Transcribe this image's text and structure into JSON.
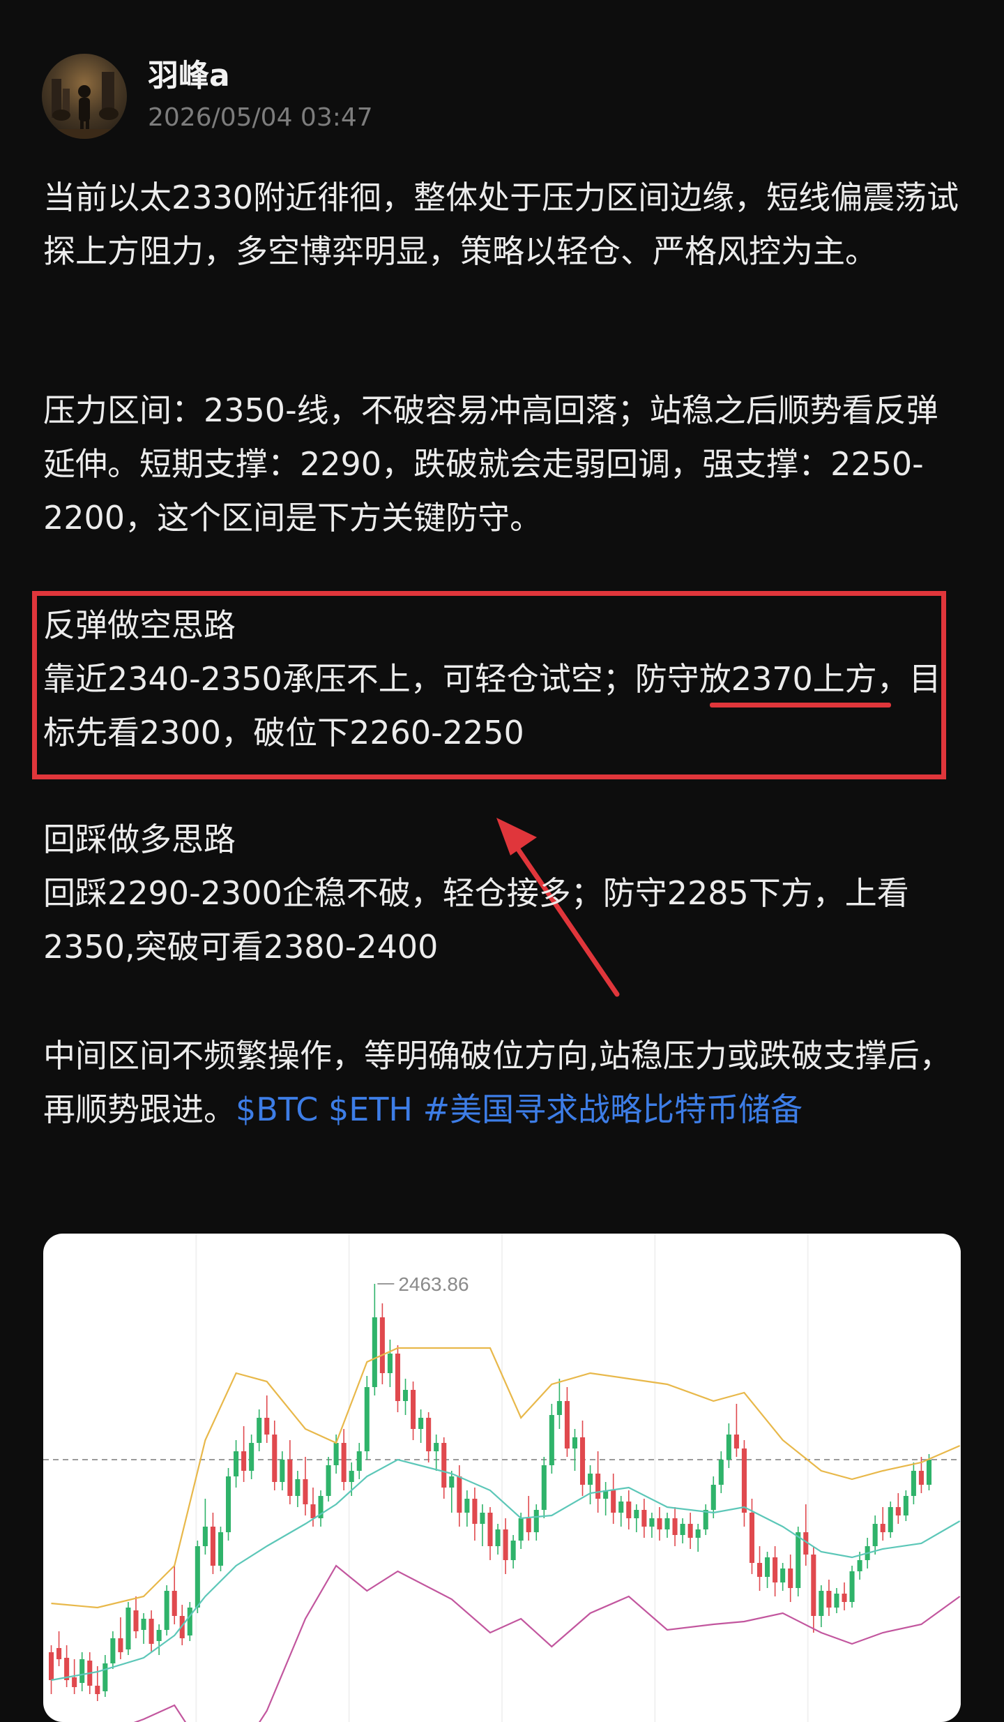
{
  "author": {
    "name": "羽峰a",
    "timestamp": "2026/05/04 03:47"
  },
  "post": {
    "para1": "当前以太2330附近徘徊，整体处于压力区间边缘，短线偏震荡试探上方阻力，多空博弈明显，策略以轻仓、严格风控为主。",
    "para2": "压力区间：2350-线，不破容易冲高回落；站稳之后顺势看反弹延伸。短期支撑：2290，跌破就会走弱回调，强支撑：2250-2200，这个区间是下方关键防守。",
    "para3_title": "反弹做空思路",
    "para3_body": "靠近2340-2350承压不上，可轻仓试空；防守放2370上方，目标先看2300，破位下2260-2250",
    "para4_title": "回踩做多思路",
    "para4_body": "回踩2290-2300企稳不破，轻仓接多；防守2285下方，上看2350,突破可看2380-2400",
    "para5_text": "中间区间不频繁操作，等明确破位方向,站稳压力或跌破支撑后，再顺势跟进。",
    "tags": [
      "$BTC",
      "$ETH",
      "#美国寻求战略比特币储备"
    ]
  },
  "colors": {
    "background": "#0d0d0d",
    "text": "#ececec",
    "tag": "#3d7de6",
    "annotation_red": "#e0363b",
    "candle_up": "#2fb36a",
    "candle_down": "#e0494e",
    "band_upper": "#e8b84a",
    "band_mid": "#5cc7b8",
    "band_lower": "#c2569e"
  },
  "chart_data": {
    "type": "candlestick",
    "high_label": "2463.86",
    "ylim": [
      2150,
      2480
    ],
    "candles": [
      [
        2200,
        2205,
        2180,
        2170
      ],
      [
        2203,
        2215,
        2195,
        2190
      ],
      [
        2196,
        2205,
        2180,
        2175
      ],
      [
        2182,
        2195,
        2175,
        2170
      ],
      [
        2178,
        2200,
        2195,
        2172
      ],
      [
        2194,
        2200,
        2176,
        2170
      ],
      [
        2176,
        2190,
        2170,
        2165
      ],
      [
        2172,
        2198,
        2192,
        2168
      ],
      [
        2192,
        2215,
        2210,
        2188
      ],
      [
        2210,
        2225,
        2200,
        2195
      ],
      [
        2202,
        2236,
        2232,
        2198
      ],
      [
        2230,
        2240,
        2215,
        2210
      ],
      [
        2216,
        2228,
        2224,
        2206
      ],
      [
        2224,
        2230,
        2206,
        2200
      ],
      [
        2208,
        2220,
        2216,
        2198
      ],
      [
        2216,
        2248,
        2244,
        2212
      ],
      [
        2244,
        2262,
        2226,
        2220
      ],
      [
        2226,
        2234,
        2210,
        2205
      ],
      [
        2212,
        2236,
        2232,
        2208
      ],
      [
        2232,
        2280,
        2276,
        2228
      ],
      [
        2276,
        2310,
        2290,
        2270
      ],
      [
        2290,
        2300,
        2262,
        2256
      ],
      [
        2262,
        2290,
        2286,
        2258
      ],
      [
        2286,
        2332,
        2326,
        2280
      ],
      [
        2326,
        2352,
        2344,
        2318
      ],
      [
        2344,
        2362,
        2330,
        2322
      ],
      [
        2330,
        2356,
        2350,
        2324
      ],
      [
        2350,
        2374,
        2368,
        2344
      ],
      [
        2368,
        2384,
        2356,
        2350
      ],
      [
        2356,
        2366,
        2322,
        2316
      ],
      [
        2322,
        2344,
        2338,
        2316
      ],
      [
        2338,
        2352,
        2312,
        2306
      ],
      [
        2312,
        2330,
        2324,
        2304
      ],
      [
        2324,
        2340,
        2306,
        2298
      ],
      [
        2306,
        2318,
        2296,
        2290
      ],
      [
        2296,
        2316,
        2312,
        2290
      ],
      [
        2312,
        2340,
        2334,
        2308
      ],
      [
        2334,
        2356,
        2350,
        2328
      ],
      [
        2350,
        2360,
        2322,
        2316
      ],
      [
        2322,
        2336,
        2330,
        2312
      ],
      [
        2330,
        2350,
        2344,
        2324
      ],
      [
        2344,
        2398,
        2390,
        2338
      ],
      [
        2390,
        2464,
        2440,
        2384
      ],
      [
        2440,
        2450,
        2400,
        2392
      ],
      [
        2400,
        2424,
        2414,
        2390
      ],
      [
        2414,
        2420,
        2380,
        2372
      ],
      [
        2380,
        2396,
        2388,
        2370
      ],
      [
        2388,
        2394,
        2360,
        2352
      ],
      [
        2360,
        2374,
        2368,
        2350
      ],
      [
        2368,
        2372,
        2344,
        2336
      ],
      [
        2344,
        2356,
        2350,
        2330
      ],
      [
        2350,
        2354,
        2318,
        2310
      ],
      [
        2318,
        2330,
        2326,
        2300
      ],
      [
        2326,
        2334,
        2300,
        2290
      ],
      [
        2300,
        2316,
        2310,
        2290
      ],
      [
        2310,
        2318,
        2292,
        2280
      ],
      [
        2292,
        2306,
        2300,
        2276
      ],
      [
        2300,
        2304,
        2276,
        2266
      ],
      [
        2276,
        2292,
        2288,
        2270
      ],
      [
        2288,
        2296,
        2266,
        2256
      ],
      [
        2266,
        2284,
        2280,
        2260
      ],
      [
        2280,
        2300,
        2296,
        2274
      ],
      [
        2296,
        2312,
        2286,
        2280
      ],
      [
        2286,
        2306,
        2302,
        2280
      ],
      [
        2302,
        2340,
        2334,
        2296
      ],
      [
        2334,
        2378,
        2370,
        2328
      ],
      [
        2370,
        2396,
        2380,
        2360
      ],
      [
        2380,
        2390,
        2346,
        2340
      ],
      [
        2346,
        2360,
        2354,
        2330
      ],
      [
        2354,
        2366,
        2320,
        2312
      ],
      [
        2320,
        2334,
        2328,
        2306
      ],
      [
        2328,
        2344,
        2310,
        2300
      ],
      [
        2310,
        2322,
        2316,
        2298
      ],
      [
        2316,
        2328,
        2300,
        2292
      ],
      [
        2300,
        2312,
        2308,
        2290
      ],
      [
        2308,
        2316,
        2296,
        2288
      ],
      [
        2296,
        2306,
        2302,
        2286
      ],
      [
        2302,
        2310,
        2290,
        2282
      ],
      [
        2290,
        2300,
        2296,
        2282
      ],
      [
        2296,
        2304,
        2288,
        2280
      ],
      [
        2288,
        2300,
        2296,
        2282
      ],
      [
        2296,
        2304,
        2284,
        2276
      ],
      [
        2284,
        2296,
        2292,
        2278
      ],
      [
        2292,
        2300,
        2282,
        2274
      ],
      [
        2282,
        2292,
        2288,
        2272
      ],
      [
        2288,
        2306,
        2302,
        2284
      ],
      [
        2302,
        2326,
        2320,
        2296
      ],
      [
        2320,
        2344,
        2338,
        2314
      ],
      [
        2338,
        2364,
        2356,
        2332
      ],
      [
        2356,
        2378,
        2346,
        2340
      ],
      [
        2346,
        2352,
        2300,
        2290
      ],
      [
        2300,
        2310,
        2264,
        2256
      ],
      [
        2264,
        2276,
        2254,
        2244
      ],
      [
        2254,
        2272,
        2268,
        2246
      ],
      [
        2268,
        2276,
        2250,
        2240
      ],
      [
        2250,
        2264,
        2260,
        2244
      ],
      [
        2260,
        2270,
        2246,
        2236
      ],
      [
        2246,
        2290,
        2286,
        2240
      ],
      [
        2286,
        2306,
        2270,
        2262
      ],
      [
        2270,
        2276,
        2226,
        2214
      ],
      [
        2226,
        2248,
        2244,
        2218
      ],
      [
        2244,
        2252,
        2232,
        2226
      ],
      [
        2232,
        2246,
        2242,
        2228
      ],
      [
        2242,
        2250,
        2236,
        2230
      ],
      [
        2236,
        2262,
        2258,
        2232
      ],
      [
        2258,
        2272,
        2266,
        2252
      ],
      [
        2266,
        2282,
        2276,
        2260
      ],
      [
        2276,
        2298,
        2292,
        2270
      ],
      [
        2292,
        2304,
        2286,
        2280
      ],
      [
        2286,
        2308,
        2304,
        2282
      ],
      [
        2304,
        2314,
        2298,
        2292
      ],
      [
        2298,
        2316,
        2312,
        2294
      ],
      [
        2312,
        2336,
        2330,
        2306
      ],
      [
        2330,
        2340,
        2320,
        2314
      ],
      [
        2320,
        2342,
        2338,
        2316
      ]
    ],
    "bands": {
      "upper": [
        [
          0,
          2235
        ],
        [
          6,
          2232
        ],
        [
          12,
          2240
        ],
        [
          16,
          2262
        ],
        [
          20,
          2352
        ],
        [
          24,
          2400
        ],
        [
          28,
          2394
        ],
        [
          33,
          2360
        ],
        [
          37,
          2350
        ],
        [
          41,
          2408
        ],
        [
          45,
          2418
        ],
        [
          52,
          2418
        ],
        [
          57,
          2418
        ],
        [
          61,
          2368
        ],
        [
          65,
          2392
        ],
        [
          70,
          2400
        ],
        [
          75,
          2396
        ],
        [
          80,
          2392
        ],
        [
          86,
          2380
        ],
        [
          90,
          2386
        ],
        [
          95,
          2352
        ],
        [
          100,
          2330
        ],
        [
          104,
          2324
        ],
        [
          108,
          2330
        ],
        [
          113,
          2336
        ],
        [
          118,
          2348
        ]
      ],
      "mid": [
        [
          0,
          2180
        ],
        [
          6,
          2186
        ],
        [
          12,
          2196
        ],
        [
          16,
          2212
        ],
        [
          20,
          2240
        ],
        [
          24,
          2262
        ],
        [
          28,
          2276
        ],
        [
          33,
          2292
        ],
        [
          37,
          2306
        ],
        [
          41,
          2326
        ],
        [
          45,
          2338
        ],
        [
          52,
          2328
        ],
        [
          57,
          2316
        ],
        [
          61,
          2296
        ],
        [
          65,
          2298
        ],
        [
          70,
          2314
        ],
        [
          75,
          2318
        ],
        [
          80,
          2304
        ],
        [
          86,
          2300
        ],
        [
          90,
          2304
        ],
        [
          95,
          2290
        ],
        [
          100,
          2272
        ],
        [
          104,
          2268
        ],
        [
          108,
          2274
        ],
        [
          113,
          2278
        ],
        [
          118,
          2294
        ]
      ],
      "lower": [
        [
          0,
          2125
        ],
        [
          6,
          2140
        ],
        [
          12,
          2152
        ],
        [
          16,
          2162
        ],
        [
          20,
          2128
        ],
        [
          24,
          2124
        ],
        [
          28,
          2158
        ],
        [
          33,
          2224
        ],
        [
          37,
          2262
        ],
        [
          41,
          2244
        ],
        [
          45,
          2258
        ],
        [
          52,
          2238
        ],
        [
          57,
          2214
        ],
        [
          61,
          2224
        ],
        [
          65,
          2204
        ],
        [
          70,
          2228
        ],
        [
          75,
          2240
        ],
        [
          80,
          2216
        ],
        [
          86,
          2220
        ],
        [
          90,
          2222
        ],
        [
          95,
          2228
        ],
        [
          100,
          2214
        ],
        [
          104,
          2206
        ],
        [
          108,
          2214
        ],
        [
          113,
          2220
        ],
        [
          118,
          2240
        ]
      ]
    }
  }
}
